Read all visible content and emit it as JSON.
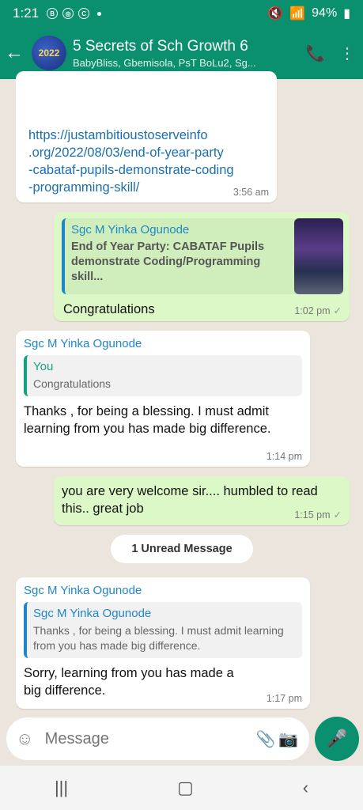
{
  "status": {
    "time": "1:21",
    "battery": "94%"
  },
  "header": {
    "title": "5 Secrets of Sch Growth 6",
    "subtitle": "BabyBliss, Gbemisola, PsT BoLu2, Sg...",
    "avatar_text": "2022"
  },
  "messages": [
    {
      "id": "m1",
      "dir": "in",
      "link": "https://justambitioustoserveinfo.org/2022/08/03/end-of-year-party-cabataf-pupils-demonstrate-coding-programming-skill/",
      "link_lines": [
        "https://justambitioustoserveinfo",
        ".org/2022/08/03/end-of-year-party",
        "-cabataf-pupils-demonstrate-coding",
        "-programming-skill/"
      ],
      "time": "3:56 am"
    },
    {
      "id": "m2",
      "dir": "out",
      "quote_name": "Sgc M Yinka Ogunode",
      "quote_text": "End of Year Party: CABATAF Pupils demonstrate Coding/Programming skill...",
      "text": "Congratulations",
      "time": "1:02 pm"
    },
    {
      "id": "m3",
      "dir": "in",
      "sender": "Sgc M Yinka Ogunode",
      "quote_name": "You",
      "quote_text": "Congratulations",
      "text": "Thanks ,  for being a blessing.  I must admit  learning from you has made big difference.",
      "time": "1:14 pm"
    },
    {
      "id": "m4",
      "dir": "out",
      "text": "you are very welcome sir.... humbled to read this.. great job",
      "time": "1:15 pm"
    },
    {
      "id": "m5",
      "dir": "in",
      "sender": "Sgc M Yinka Ogunode",
      "quote_name": "Sgc M Yinka Ogunode",
      "quote_text": "Thanks ,  for being a blessing.  I must admit learning from you has made big difference.",
      "text": "Sorry,  learning from you has made a  big difference.",
      "time": "1:17 pm"
    }
  ],
  "unread_label": "1 Unread Message",
  "input": {
    "placeholder": "Message"
  },
  "icons": {
    "back": "arrow-left-icon",
    "call": "add-call-icon",
    "menu": "more-vert-icon",
    "emoji": "emoji-icon",
    "attach": "paperclip-icon",
    "camera": "camera-icon",
    "mic": "mic-icon"
  },
  "colors": {
    "header": "#0a8f6f",
    "outgoing": "#dcf8c6",
    "incoming": "#ffffff",
    "background": "#ece5dd",
    "sender": "#1f87c8"
  }
}
